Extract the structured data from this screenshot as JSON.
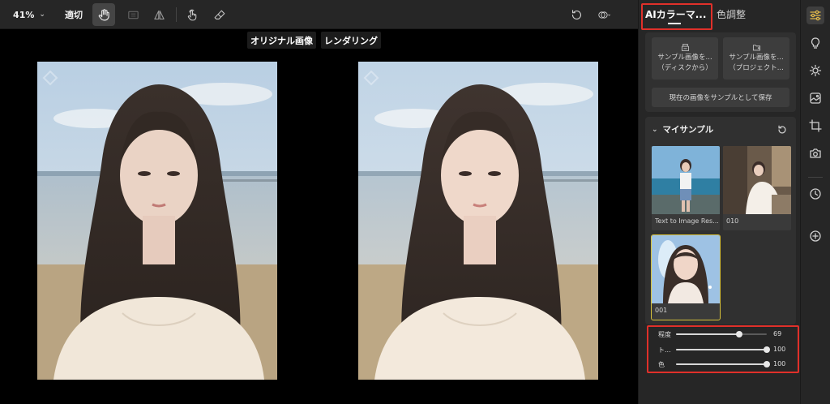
{
  "toolbar": {
    "zoom": "41%",
    "fit_label": "適切",
    "icons": [
      "hand-icon",
      "compare-box-icon",
      "mirror-icon",
      "touch-icon",
      "eraser-icon",
      "rotate-icon",
      "overlay-icon"
    ]
  },
  "canvas": {
    "original_label": "オリジナル画像",
    "rendering_label": "レンダリング"
  },
  "panel": {
    "tab_active": "AIカラーマ...",
    "tab_inactive": "色調整",
    "sample_buttons": [
      {
        "line1": "サンプル画像を...",
        "line2": "（ディスクから）"
      },
      {
        "line1": "サンプル画像を...",
        "line2": "（プロジェクト..."
      }
    ],
    "save_sample": "現在の画像をサンプルとして保存",
    "my_samples_title": "マイサンプル",
    "samples": [
      {
        "label": "Text to Image Res...",
        "selected": false
      },
      {
        "label": "010",
        "selected": false
      },
      {
        "label": "001",
        "selected": true
      }
    ],
    "sliders": [
      {
        "label": "程度",
        "value": 69,
        "fraction": 0.7
      },
      {
        "label": "ト...",
        "value": 100,
        "fraction": 1.0
      },
      {
        "label": "色",
        "value": 100,
        "fraction": 1.0
      }
    ]
  },
  "rail": {
    "icons": [
      "sliders-icon",
      "bulb-icon",
      "sun-icon",
      "image-icon",
      "crop-icon",
      "camera-icon",
      "clock-icon",
      "add-circle-icon"
    ],
    "active": "sliders-icon"
  },
  "colors": {
    "accent_red": "#e0302a",
    "selected_outline": "#d8c23a",
    "panel_bg": "#262626"
  }
}
